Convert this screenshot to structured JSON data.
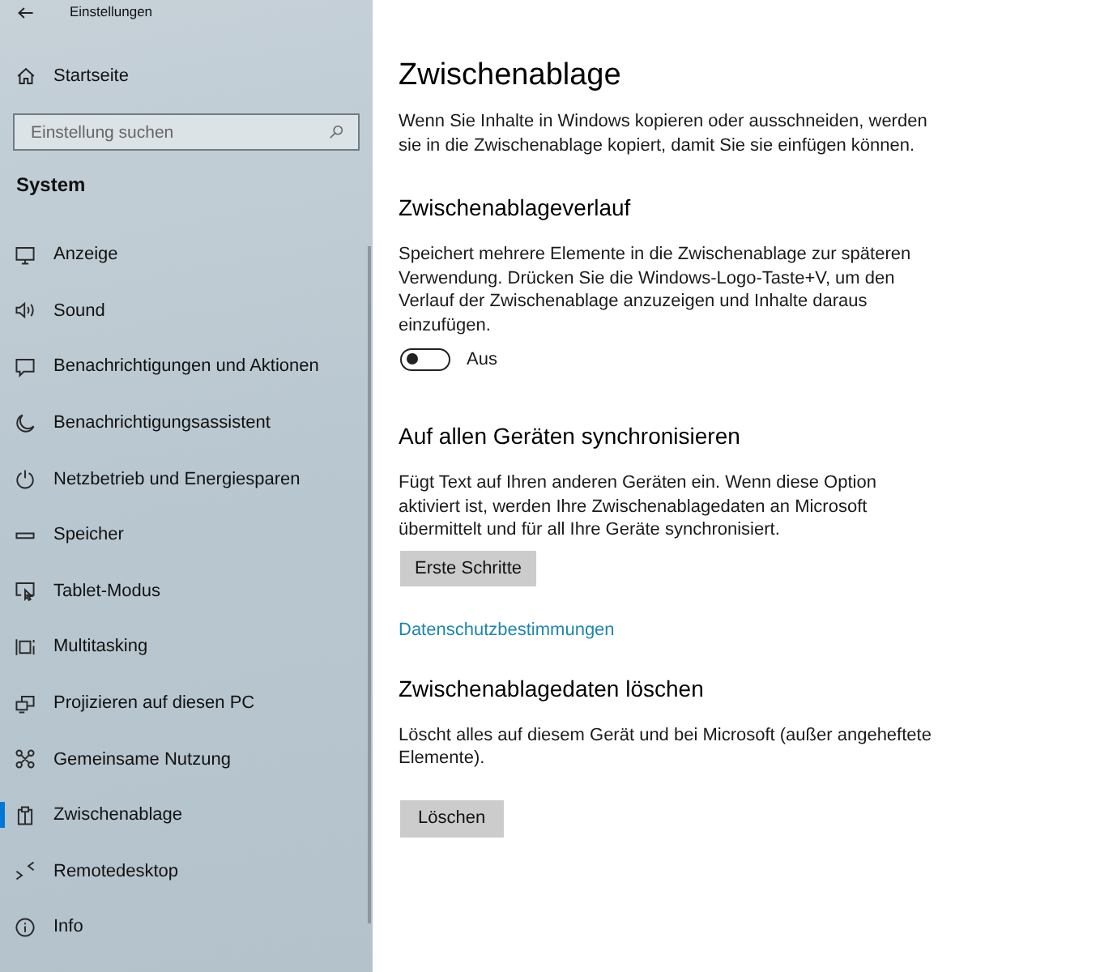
{
  "window": {
    "title": "Einstellungen"
  },
  "sidebar": {
    "home": "Startseite",
    "search": {
      "placeholder": "Einstellung suchen"
    },
    "section": "System",
    "items": [
      {
        "label": "Anzeige",
        "selected": false
      },
      {
        "label": "Sound",
        "selected": false
      },
      {
        "label": "Benachrichtigungen und Aktionen",
        "selected": false
      },
      {
        "label": "Benachrichtigungsassistent",
        "selected": false
      },
      {
        "label": "Netzbetrieb und Energiesparen",
        "selected": false
      },
      {
        "label": "Speicher",
        "selected": false
      },
      {
        "label": "Tablet-Modus",
        "selected": false
      },
      {
        "label": "Multitasking",
        "selected": false
      },
      {
        "label": "Projizieren auf diesen PC",
        "selected": false
      },
      {
        "label": "Gemeinsame Nutzung",
        "selected": false
      },
      {
        "label": "Zwischenablage",
        "selected": true
      },
      {
        "label": "Remotedesktop",
        "selected": false
      },
      {
        "label": "Info",
        "selected": false
      }
    ]
  },
  "page": {
    "title": "Zwischenablage",
    "intro": "Wenn Sie Inhalte in Windows kopieren oder ausschneiden, werden sie in die Zwischenablage kopiert, damit Sie sie einfügen können.",
    "sections": [
      {
        "kind": "toggle",
        "heading": "Zwischenablageverlauf",
        "text": "Speichert mehrere Elemente in die Zwischenablage zur späteren Verwendung. Drücken Sie die Windows-Logo-Taste+V, um den Verlauf der Zwischenablage anzuzeigen und Inhalte daraus einzufügen.",
        "toggle": {
          "on": false,
          "label": "Aus"
        }
      },
      {
        "kind": "button",
        "heading": "Auf allen Geräten synchronisieren",
        "text": "Fügt Text auf Ihren anderen Geräten ein. Wenn diese Option aktiviert ist, werden Ihre Zwischenablagedaten an Microsoft übermittelt und für all Ihre Geräte synchronisiert.",
        "button": "Erste Schritte",
        "link": "Datenschutzbestimmungen"
      },
      {
        "kind": "button",
        "heading": "Zwischenablagedaten löschen",
        "text": "Löscht alles auf diesem Gerät und bei Microsoft (außer angeheftete Elemente).",
        "button": "Löschen"
      }
    ]
  }
}
